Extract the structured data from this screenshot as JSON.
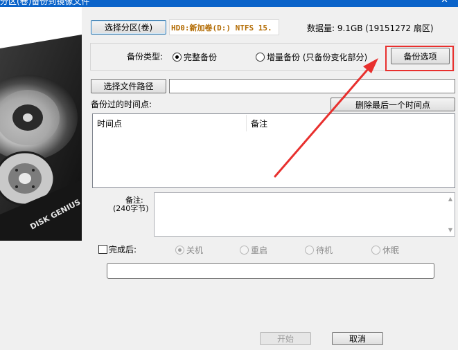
{
  "window": {
    "title": "分区(卷)备份到镜像文件"
  },
  "header": {
    "select_partition_label": "选择分区(卷)",
    "partition_info": "HD0:新加卷(D:) NTFS 15.",
    "data_size": "数据量: 9.1GB (19151272 扇区)"
  },
  "backup_type": {
    "label": "备份类型:",
    "full": "完整备份",
    "incremental": "增量备份 (只备份变化部分)",
    "options_button": "备份选项",
    "full_selected": true
  },
  "path": {
    "select_button": "选择文件路径",
    "value": ""
  },
  "timepoints": {
    "label": "备份过的时间点:",
    "delete_last_button": "删除最后一个时间点",
    "columns": [
      "时间点",
      "备注"
    ]
  },
  "remark": {
    "label": "备注:",
    "hint": "(240字节)"
  },
  "after_complete": {
    "label": "完成后:",
    "options": [
      "关机",
      "重启",
      "待机",
      "休眠"
    ],
    "selected_index": 0
  },
  "footer": {
    "start_button": "开始",
    "cancel_button": "取消"
  },
  "side_image": {
    "brand_text": "DISK GENIUS"
  },
  "colors": {
    "accent_red": "#e8302e",
    "partition_text": "#b26a00",
    "title_bar": "#0a63c9"
  }
}
